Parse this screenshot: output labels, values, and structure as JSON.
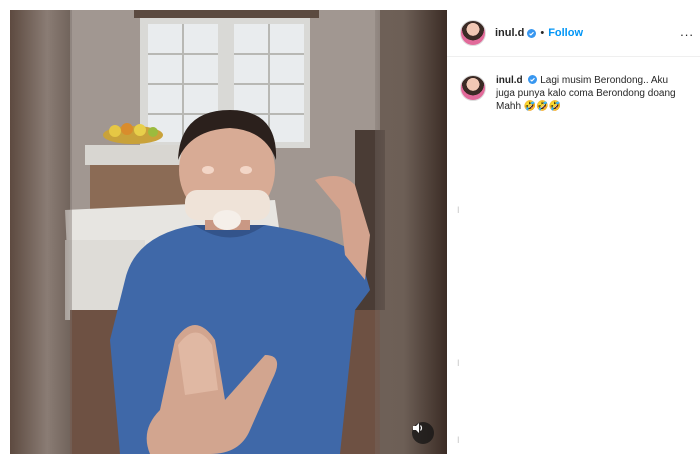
{
  "post": {
    "username": "inul.d",
    "follow_label": "Follow",
    "separator": "•",
    "more_label": "...",
    "caption_text": "Lagi musim Berondong.. Aku juga punya kalo coma Berondong doang Mahh 🤣🤣🤣"
  },
  "media": {
    "sound_icon": "speaker-icon"
  },
  "colors": {
    "accent": "#0095f6",
    "text": "#262626",
    "border": "#efefef"
  }
}
